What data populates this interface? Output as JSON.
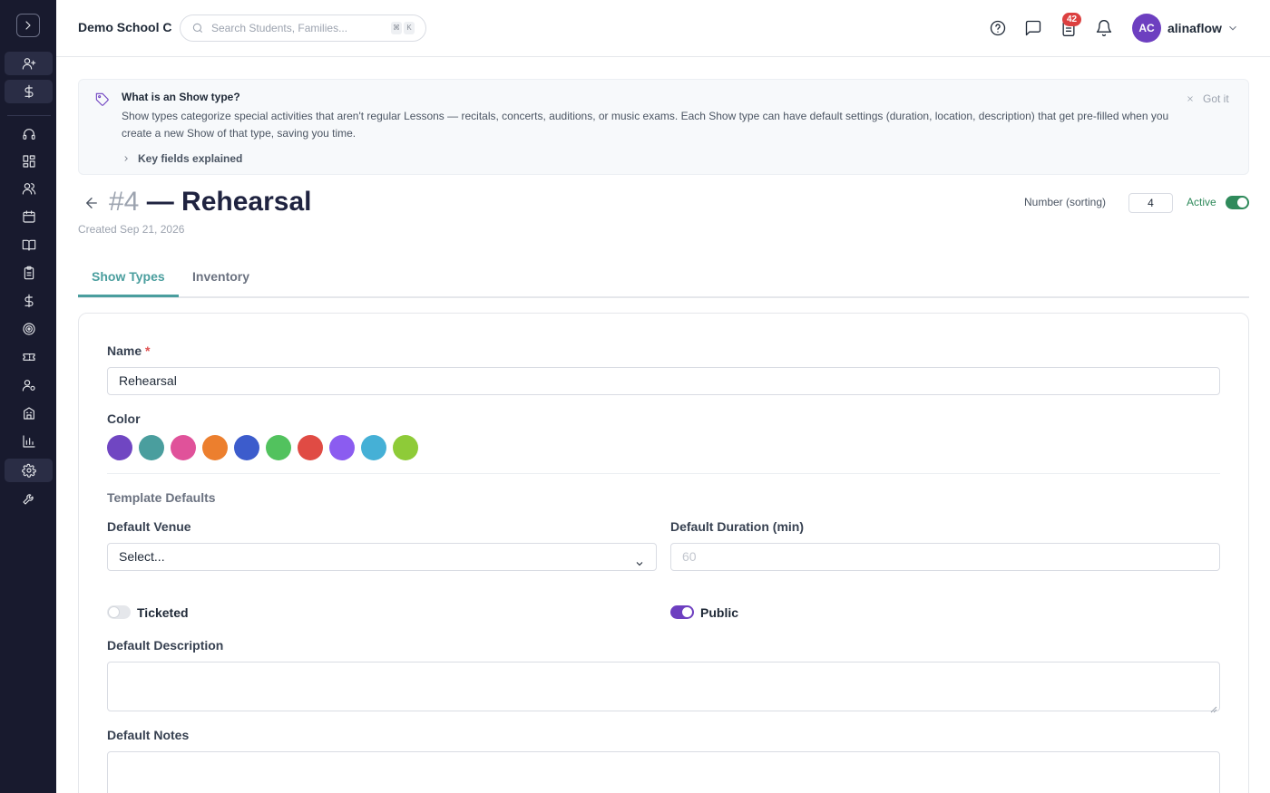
{
  "sidebar": {
    "icons": [
      "chevron-right-icon",
      "user-plus-icon",
      "dollar-icon",
      "headset-icon",
      "dashboard-icon",
      "users-icon",
      "calendar-icon",
      "book-icon",
      "clipboard-icon",
      "dollar-icon",
      "target-icon",
      "ticket-icon",
      "user-settings-icon",
      "building-icon",
      "bar-chart-icon",
      "gear-icon",
      "wrench-icon"
    ],
    "active_item": "settings"
  },
  "header": {
    "school_name": "Demo School C",
    "search_placeholder": "Search Students, Families...",
    "shortcut_keys": [
      "⌘",
      "K"
    ],
    "tasks_badge": "42",
    "user": {
      "initials": "AC",
      "name": "alinaflow"
    }
  },
  "info": {
    "title": "What is an Show type?",
    "body": "Show types categorize special activities that aren't regular Lessons — recitals, concerts, auditions, or music exams. Each Show type can have default settings (duration, location, description) that get pre-filled when you create a new Show of that type, saving you time.",
    "expand_label": "Key fields explained",
    "dismiss_label": "Got it"
  },
  "record": {
    "number_prefix": "#4",
    "title": "— Rehearsal",
    "created": "Created Sep 21, 2026",
    "sort_label": "Number (sorting)",
    "sort_value": "4",
    "active_label": "Active",
    "active": true
  },
  "tabs": [
    {
      "label": "Show Types",
      "active": true
    },
    {
      "label": "Inventory",
      "active": false
    }
  ],
  "form": {
    "name_label": "Name",
    "required_mark": "*",
    "name_value": "Rehearsal",
    "color_label": "Color",
    "colors": [
      "#7046c2",
      "#4a9e9e",
      "#e0529a",
      "#ec7f2e",
      "#3c5ccc",
      "#52c25e",
      "#e04b44",
      "#8b5cf0",
      "#45b0d6",
      "#8ecb38"
    ],
    "template_defaults_label": "Template Defaults",
    "venue_label": "Default Venue",
    "venue_value": "Select...",
    "duration_label": "Default Duration (min)",
    "duration_placeholder": "60",
    "ticketed_label": "Ticketed",
    "ticketed": false,
    "public_label": "Public",
    "public": true,
    "description_label": "Default Description",
    "notes_label": "Default Notes"
  },
  "colors": {
    "sidebar_bg": "#181a2e",
    "accent_teal": "#4a9e9e",
    "accent_purple": "#6d3fc0",
    "active_green": "#2f8a5b"
  }
}
